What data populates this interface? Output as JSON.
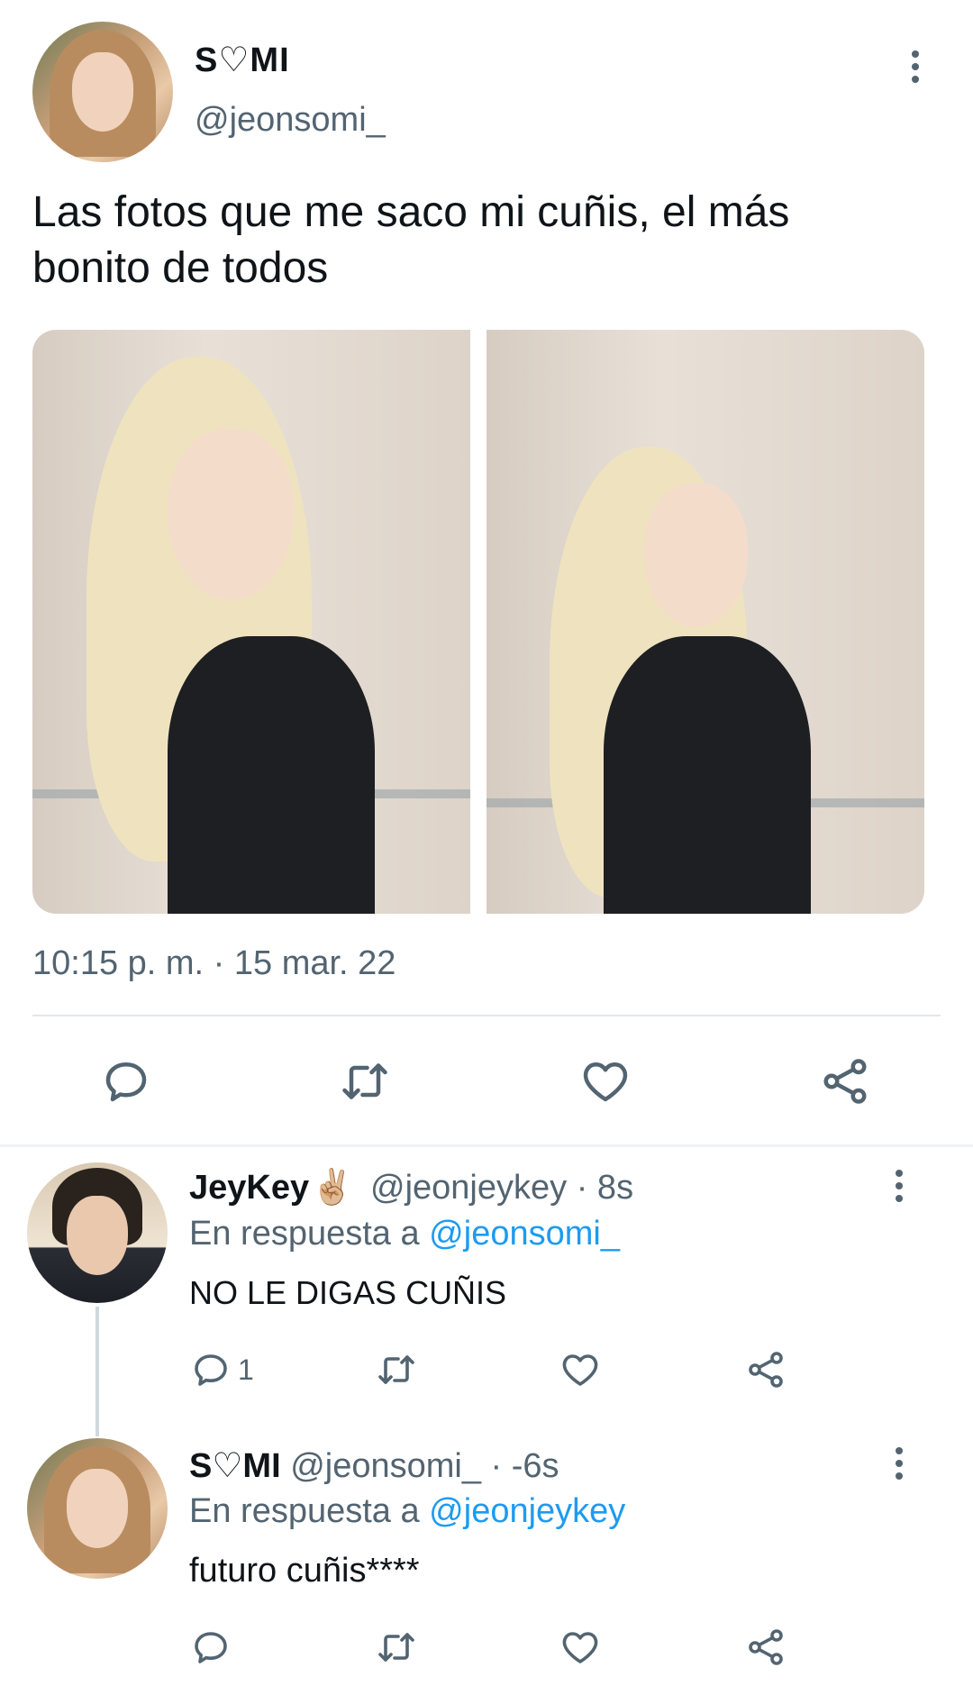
{
  "main_tweet": {
    "display_name": "S♡MI",
    "handle": "@jeonsomi_",
    "text_line1": "Las fotos que me saco mi cuñis, el más",
    "text_line2": "bonito de todos",
    "timestamp": "10:15 p. m. · 15 mar. 22",
    "actions": [
      "reply-icon",
      "retweet-icon",
      "like-icon",
      "share-icon"
    ]
  },
  "replies": [
    {
      "display_name": "JeyKey",
      "emoji": "✌🏼",
      "handle": "@jeonjeykey",
      "time": "· 8s",
      "reply_prefix": "En respuesta a",
      "reply_to": "@jeonsomi_",
      "text": "NO LE DIGAS CUÑIS",
      "reply_count": "1"
    },
    {
      "display_name": "S♡MI",
      "handle": "@jeonsomi_",
      "time": "· -6s",
      "reply_prefix": "En respuesta a",
      "reply_to": "@jeonjeykey",
      "text": "futuro cuñis****",
      "reply_count": ""
    }
  ],
  "colors": {
    "text": "#0f1419",
    "secondary": "#536471",
    "link": "#1d9bf0",
    "divider": "#e1e6ea"
  }
}
